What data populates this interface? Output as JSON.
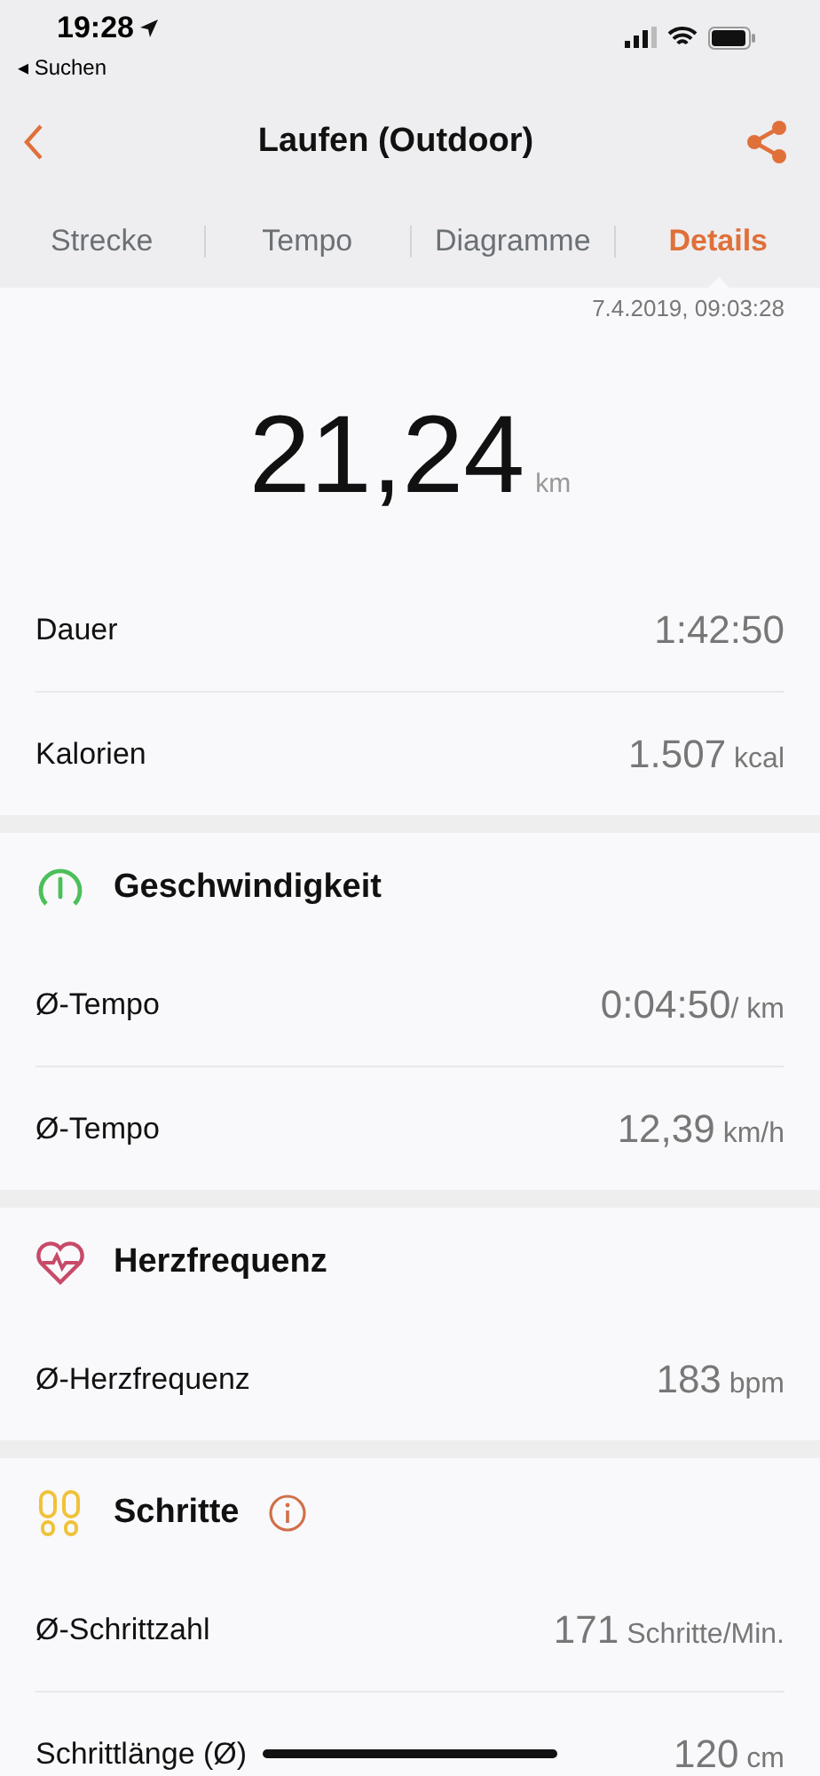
{
  "status_bar": {
    "time": "19:28",
    "back_label": "◂ Suchen"
  },
  "nav": {
    "title": "Laufen (Outdoor)"
  },
  "tabs": [
    {
      "label": "Strecke",
      "selected": false
    },
    {
      "label": "Tempo",
      "selected": false
    },
    {
      "label": "Diagramme",
      "selected": false
    },
    {
      "label": "Details",
      "selected": true
    }
  ],
  "date": "7.4.2019, 09:03:28",
  "distance": {
    "value": "21,24",
    "unit": "km"
  },
  "summary": [
    {
      "label": "Dauer",
      "value": "1:42:50"
    },
    {
      "label": "Kalorien",
      "value": "1.507",
      "unit": "kcal"
    }
  ],
  "sections": [
    {
      "title": "Geschwindigkeit",
      "kind": "speed",
      "rows": [
        {
          "label": "Ø-Tempo",
          "value": "0:04:50",
          "unit": "/ km"
        },
        {
          "label": "Ø-Tempo",
          "value": "12,39",
          "unit": "km/h"
        }
      ]
    },
    {
      "title": "Herzfrequenz",
      "kind": "heart",
      "rows": [
        {
          "label": "Ø-Herzfrequenz",
          "value": "183",
          "unit": "bpm"
        }
      ]
    },
    {
      "title": "Schritte",
      "kind": "steps",
      "info": true,
      "rows": [
        {
          "label": "Ø-Schrittzahl",
          "value": "171",
          "unit": "Schritte/Min."
        },
        {
          "label": "Schrittlänge (Ø)",
          "value": "120",
          "unit": "cm"
        }
      ]
    }
  ]
}
